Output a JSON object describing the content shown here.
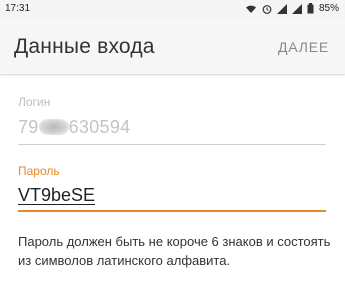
{
  "status_bar": {
    "time": "17:31",
    "icons": [
      "wifi-icon",
      "alarm-icon",
      "signal-icon",
      "battery-icon"
    ],
    "battery_percent": "85%"
  },
  "app_bar": {
    "title": "Данные входа",
    "next_label": "ДАЛЕЕ"
  },
  "login_field": {
    "label": "Логин",
    "value_prefix": "79",
    "value_suffix": "630594"
  },
  "password_field": {
    "label": "Пароль",
    "value": "VT9beSE"
  },
  "hint_text": "Пароль должен быть не короче 6 знаков и состоять из символов латинского алфавита.",
  "colors": {
    "accent": "#e8862a",
    "inactive_text": "#bdbdbd",
    "app_bar_bg": "#f7f7f7"
  }
}
